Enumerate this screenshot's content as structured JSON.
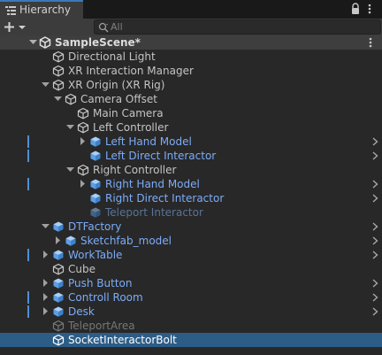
{
  "window": {
    "tab_label": "Hierarchy",
    "tab_icon": "list-icon"
  },
  "toolbar": {
    "create_icon": "plus-icon",
    "search_placeholder": "All",
    "search_value": ""
  },
  "scene": {
    "name": "SampleScene*",
    "icon": "unity-logo-icon"
  },
  "items": [
    {
      "label": "Directional Light",
      "style": "normal",
      "icon": "cube-icon"
    },
    {
      "label": "XR Interaction Manager",
      "style": "normal",
      "icon": "cube-icon"
    },
    {
      "label": "XR Origin (XR Rig)",
      "style": "normal",
      "icon": "cube-icon"
    },
    {
      "label": "Camera Offset",
      "style": "normal",
      "icon": "cube-icon"
    },
    {
      "label": "Main Camera",
      "style": "normal",
      "icon": "cube-icon"
    },
    {
      "label": "Left Controller",
      "style": "normal",
      "icon": "cube-icon"
    },
    {
      "label": "Left Hand Model",
      "style": "prefab",
      "icon": "prefab-icon"
    },
    {
      "label": "Left Direct Interactor",
      "style": "prefab",
      "icon": "prefab-icon"
    },
    {
      "label": "Right Controller",
      "style": "normal",
      "icon": "cube-icon"
    },
    {
      "label": "Right Hand Model",
      "style": "prefab",
      "icon": "prefab-icon"
    },
    {
      "label": "Right Direct Interactor",
      "style": "prefab",
      "icon": "prefab-icon"
    },
    {
      "label": "Teleport Interactor",
      "style": "disabled-prefab",
      "icon": "prefab-icon"
    },
    {
      "label": "DTFactory",
      "style": "prefab",
      "icon": "prefab-icon"
    },
    {
      "label": "Sketchfab_model",
      "style": "prefab",
      "icon": "prefab-icon"
    },
    {
      "label": "WorkTable",
      "style": "prefab",
      "icon": "prefab-icon"
    },
    {
      "label": "Cube",
      "style": "normal",
      "icon": "cube-icon"
    },
    {
      "label": "Push Button",
      "style": "prefab",
      "icon": "prefab-icon"
    },
    {
      "label": "Controll Room",
      "style": "prefab",
      "icon": "prefab-icon"
    },
    {
      "label": "Desk",
      "style": "prefab",
      "icon": "prefab-icon"
    },
    {
      "label": "TeleportArea",
      "style": "disabled",
      "icon": "cube-icon"
    },
    {
      "label": "SocketInteractorBolt",
      "style": "selected",
      "icon": "cube-icon"
    }
  ],
  "colors": {
    "prefab_text": "#7cacf8",
    "selection": "#2c5d87",
    "override_bar": "#4e8fd1"
  }
}
